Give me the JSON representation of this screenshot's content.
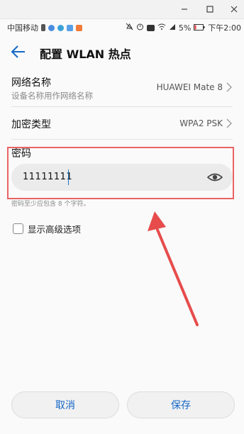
{
  "status_bar": {
    "carrier": "中国移动",
    "battery_percent": "5%",
    "time": "下午2:00",
    "icons": [
      "sim-card-icon",
      "app-icon-1",
      "app-icon-2",
      "app-icon-3",
      "app-icon-4",
      "alarm-off-icon",
      "alarm-icon",
      "hd-icon",
      "wifi-icon",
      "signal-icon",
      "battery-icon"
    ]
  },
  "header": {
    "title": "配置 WLAN 热点",
    "back_icon": "back-arrow-icon"
  },
  "network_name": {
    "label": "网络名称",
    "sublabel": "设备名称用作网络名称",
    "value": "HUAWEI Mate 8"
  },
  "encryption": {
    "label": "加密类型",
    "value": "WPA2 PSK"
  },
  "password": {
    "label": "密码",
    "value": "11111111",
    "hint": "密码至少应包含 8 个字符。",
    "visibility_icon": "eye-icon"
  },
  "advanced": {
    "label": "显示高级选项",
    "checked": false
  },
  "actions": {
    "cancel_label": "取消",
    "save_label": "保存"
  },
  "colors": {
    "accent": "#1468c8",
    "annotation": "#e96464",
    "input_bg": "#ebebeb"
  }
}
